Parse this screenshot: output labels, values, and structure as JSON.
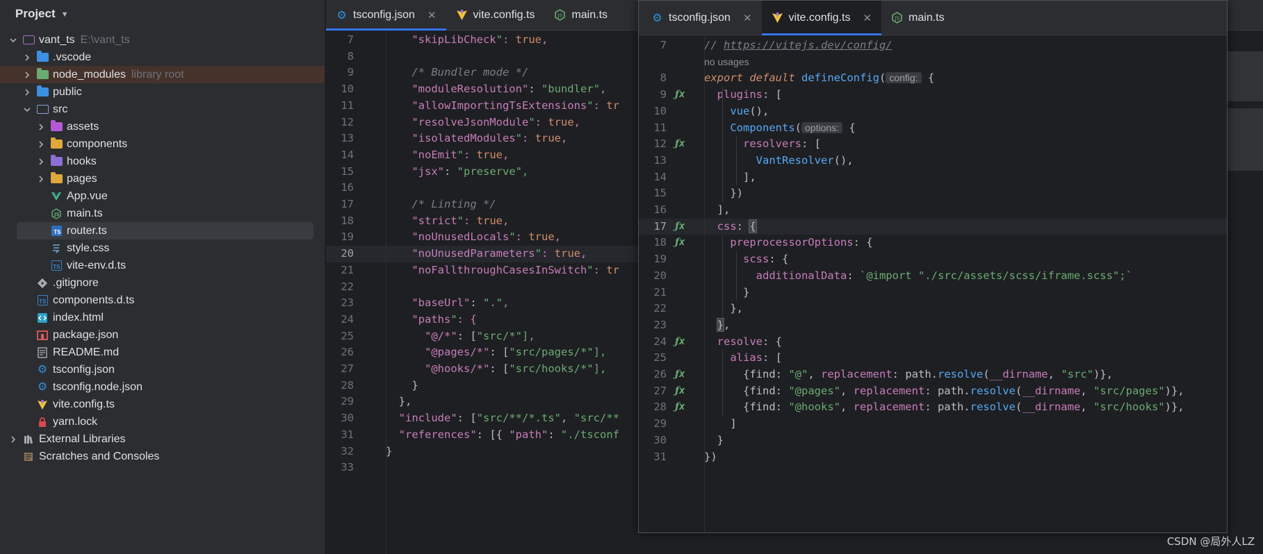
{
  "project_panel": {
    "title": "Project",
    "tree": [
      {
        "label": "vant_ts",
        "hint": "E:\\vant_ts",
        "icon": "folder-icon",
        "expanded": true
      },
      {
        "label": ".vscode",
        "icon": "vscode-folder-icon"
      },
      {
        "label": "node_modules",
        "hint": "library root",
        "icon": "node-modules-folder-icon"
      },
      {
        "label": "public",
        "icon": "public-folder-icon"
      },
      {
        "label": "src",
        "icon": "src-folder-icon",
        "expanded": true
      },
      {
        "label": "assets",
        "icon": "assets-folder-icon"
      },
      {
        "label": "components",
        "icon": "components-folder-icon"
      },
      {
        "label": "hooks",
        "icon": "hooks-folder-icon"
      },
      {
        "label": "pages",
        "icon": "pages-folder-icon"
      },
      {
        "label": "App.vue",
        "icon": "vue-file-icon"
      },
      {
        "label": "main.ts",
        "icon": "node-file-icon"
      },
      {
        "label": "router.ts",
        "icon": "ts-file-icon",
        "selected": true
      },
      {
        "label": "style.css",
        "icon": "css-file-icon"
      },
      {
        "label": "vite-env.d.ts",
        "icon": "dts-file-icon"
      },
      {
        "label": ".gitignore",
        "icon": "git-icon"
      },
      {
        "label": "components.d.ts",
        "icon": "dts-file-icon"
      },
      {
        "label": "index.html",
        "icon": "html-file-icon"
      },
      {
        "label": "package.json",
        "icon": "npm-file-icon"
      },
      {
        "label": "README.md",
        "icon": "markdown-file-icon"
      },
      {
        "label": "tsconfig.json",
        "icon": "tsconfig-icon"
      },
      {
        "label": "tsconfig.node.json",
        "icon": "tsconfig-icon"
      },
      {
        "label": "vite.config.ts",
        "icon": "vite-icon"
      },
      {
        "label": "yarn.lock",
        "icon": "lock-icon"
      },
      {
        "label": "External Libraries",
        "icon": "library-icon"
      },
      {
        "label": "Scratches and Consoles",
        "icon": "scratches-icon"
      }
    ]
  },
  "bg_editor": {
    "tabs": [
      {
        "label": "tsconfig.json",
        "active": true
      },
      {
        "label": "vite.config.ts"
      },
      {
        "label": "main.ts"
      }
    ],
    "lines": [
      {
        "n": "7",
        "t": "    \"skipLibCheck\": true,"
      },
      {
        "n": "8",
        "t": ""
      },
      {
        "n": "9",
        "t": "    /* Bundler mode */"
      },
      {
        "n": "10",
        "t": "    \"moduleResolution\": \"bundler\","
      },
      {
        "n": "11",
        "t": "    \"allowImportingTsExtensions\": tr"
      },
      {
        "n": "12",
        "t": "    \"resolveJsonModule\": true,"
      },
      {
        "n": "13",
        "t": "    \"isolatedModules\": true,"
      },
      {
        "n": "14",
        "t": "    \"noEmit\": true,"
      },
      {
        "n": "15",
        "t": "    \"jsx\": \"preserve\","
      },
      {
        "n": "16",
        "t": ""
      },
      {
        "n": "17",
        "t": "    /* Linting */"
      },
      {
        "n": "18",
        "t": "    \"strict\": true,"
      },
      {
        "n": "19",
        "t": "    \"noUnusedLocals\": true,"
      },
      {
        "n": "20",
        "t": "    \"noUnusedParameters\": true,"
      },
      {
        "n": "21",
        "t": "    \"noFallthroughCasesInSwitch\": tr"
      },
      {
        "n": "22",
        "t": ""
      },
      {
        "n": "23",
        "t": "    \"baseUrl\": \".\","
      },
      {
        "n": "24",
        "t": "    \"paths\": {"
      },
      {
        "n": "25",
        "t": "      \"@/*\": [\"src/*\"],"
      },
      {
        "n": "26",
        "t": "      \"@pages/*\": [\"src/pages/*\"],"
      },
      {
        "n": "27",
        "t": "      \"@hooks/*\": [\"src/hooks/*\"],"
      },
      {
        "n": "28",
        "t": "    }"
      },
      {
        "n": "29",
        "t": "  },"
      },
      {
        "n": "30",
        "t": "  \"include\": [\"src/**/*.ts\", \"src/**"
      },
      {
        "n": "31",
        "t": "  \"references\": [{ \"path\": \"./tsconf"
      },
      {
        "n": "32",
        "t": "}"
      },
      {
        "n": "33",
        "t": ""
      }
    ]
  },
  "float_editor": {
    "tabs": [
      {
        "label": "tsconfig.json"
      },
      {
        "label": "vite.config.ts",
        "active": true
      },
      {
        "label": "main.ts"
      }
    ],
    "usage_hint": "no usages",
    "inlay_config": "config:",
    "inlay_options": "options:",
    "lines": [
      {
        "n": "7",
        "t": "// https://vitejs.dev/config/"
      },
      {
        "n": "8",
        "t": "export default defineConfig( {"
      },
      {
        "n": "9",
        "t": "  plugins: ["
      },
      {
        "n": "10",
        "t": "    vue(),"
      },
      {
        "n": "11",
        "t": "    Components( {"
      },
      {
        "n": "12",
        "t": "      resolvers: ["
      },
      {
        "n": "13",
        "t": "        VantResolver(),"
      },
      {
        "n": "14",
        "t": "      ],"
      },
      {
        "n": "15",
        "t": "    })"
      },
      {
        "n": "16",
        "t": "  ],"
      },
      {
        "n": "17",
        "t": "  css: {"
      },
      {
        "n": "18",
        "t": "    preprocessorOptions: {"
      },
      {
        "n": "19",
        "t": "      scss: {"
      },
      {
        "n": "20",
        "t": "        additionalData: `@import \"./src/assets/scss/iframe.scss\";`"
      },
      {
        "n": "21",
        "t": "      }"
      },
      {
        "n": "22",
        "t": "    },"
      },
      {
        "n": "23",
        "t": "  },"
      },
      {
        "n": "24",
        "t": "  resolve: {"
      },
      {
        "n": "25",
        "t": "    alias: ["
      },
      {
        "n": "26",
        "t": "      {find: \"@\", replacement: path.resolve(__dirname, \"src\")},"
      },
      {
        "n": "27",
        "t": "      {find: \"@pages\", replacement: path.resolve(__dirname, \"src/pages\")},"
      },
      {
        "n": "28",
        "t": "      {find: \"@hooks\", replacement: path.resolve(__dirname, \"src/hooks\")},"
      },
      {
        "n": "29",
        "t": "    ]"
      },
      {
        "n": "30",
        "t": "  }"
      },
      {
        "n": "31",
        "t": "})"
      }
    ],
    "fx_lines": [
      "9",
      "12",
      "17",
      "18",
      "24",
      "26",
      "27",
      "28"
    ]
  },
  "watermark": "CSDN @局外人LZ",
  "colors": {
    "accent": "#3574f0",
    "string": "#6aab73",
    "key": "#c77dbb",
    "keyword": "#cf8e6d",
    "function": "#56a8f5",
    "comment": "#7a7e85"
  }
}
